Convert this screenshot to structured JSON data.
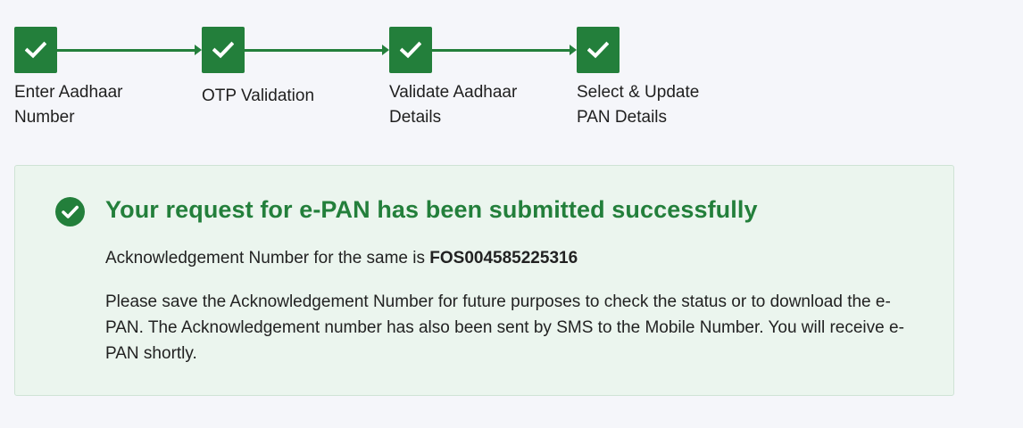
{
  "stepper": {
    "steps": [
      {
        "label": "Enter Aadhaar\nNumber",
        "status": "completed",
        "icon": "check-icon"
      },
      {
        "label": "OTP Validation",
        "status": "completed",
        "icon": "check-icon"
      },
      {
        "label": "Validate Aadhaar\nDetails",
        "status": "completed",
        "icon": "check-icon"
      },
      {
        "label": "Select & Update\nPAN Details",
        "status": "completed",
        "icon": "check-icon"
      }
    ]
  },
  "success": {
    "icon": "check-circle-icon",
    "title": "Your request for e-PAN has been submitted successfully",
    "ack_prefix": "Acknowledgement Number for the same is ",
    "ack_number": "FOS004585225316",
    "info": "Please save the Acknowledgement Number for future purposes to check the status or to download the e-PAN. The Acknowledgement number has also been sent by SMS to the Mobile Number. You will receive e-PAN shortly."
  },
  "colors": {
    "accent": "#237f3b",
    "panel_bg": "#ebf5ee",
    "page_bg": "#f5f6fa"
  }
}
